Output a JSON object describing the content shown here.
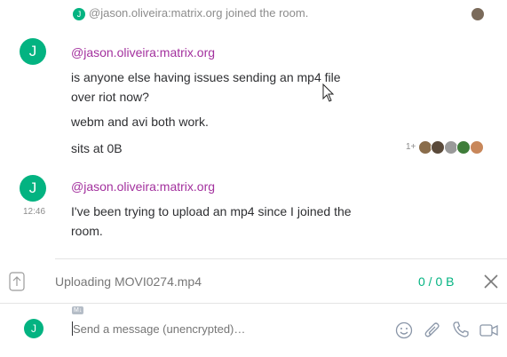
{
  "timeline": {
    "membership_event": {
      "avatar_letter": "J",
      "text": "@jason.oliveira:matrix.org joined the room."
    },
    "groups": [
      {
        "avatar_letter": "J",
        "sender": "@jason.oliveira:matrix.org",
        "messages": [
          "is anyone else having issues sending an mp4 file",
          "over riot now?",
          "webm and avi both work.",
          "sits at 0B"
        ],
        "read_receipts_overflow": "1+"
      },
      {
        "avatar_letter": "J",
        "sender": "@jason.oliveira:matrix.org",
        "timestamp": "12:46",
        "messages": [
          "I've been trying to upload an mp4 since I joined the",
          "room."
        ]
      }
    ]
  },
  "upload": {
    "label": "Uploading MOVI0274.mp4",
    "progress_text": "0 / 0 B",
    "progress_fraction": 0
  },
  "composer": {
    "avatar_letter": "J",
    "markdown_badge": "M↓",
    "placeholder": "Send a message (unencrypted)…"
  },
  "icons": {
    "upload": "upload-icon",
    "close": "close-icon",
    "emoji": "emoji-icon",
    "attach": "paperclip-icon",
    "voice_call": "phone-icon",
    "video_call": "video-camera-icon"
  },
  "colors": {
    "accent": "#03b381",
    "sender": "#a3319e",
    "muted": "#8c8c8c"
  }
}
